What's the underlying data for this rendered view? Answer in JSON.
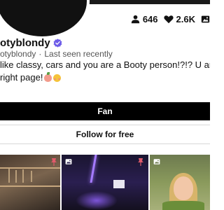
{
  "profile": {
    "display_name": "otyblondy",
    "handle": "otyblondy",
    "separator": "·",
    "last_seen": "Last seen recently",
    "bio_line1": "like classy, cars and you are a Booty person!?!? U are o",
    "bio_line2": "right page!"
  },
  "stats": {
    "photos": "646",
    "likes": "2.6K"
  },
  "actions": {
    "fan_label": "Fan",
    "follow_label": "Follow for free"
  },
  "colors": {
    "accent_verified": "#6d5ce8",
    "fan_button_bg": "#000000",
    "pin": "#e05a6a"
  },
  "icons": {
    "photos": "user-icon",
    "likes": "heart-icon",
    "media": "image-icon",
    "pinned": "pin-icon",
    "verified": "verified-badge-icon"
  }
}
